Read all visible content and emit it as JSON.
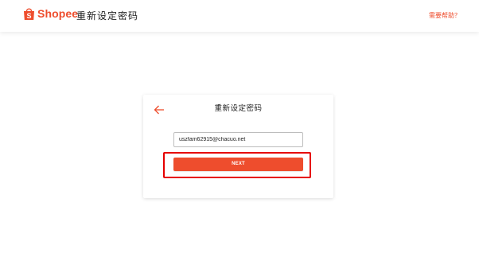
{
  "header": {
    "brand": "Shopee",
    "title": "重新设定密码",
    "help_link": "需要帮助？"
  },
  "card": {
    "title": "重新设定密码",
    "email_value": "uszfam62915@chacuo.net",
    "next_label": "NEXT"
  },
  "colors": {
    "brand": "#ee4d2d",
    "highlight": "#e60000"
  },
  "icons": {
    "logo": "shopee-bag-logo-icon",
    "back": "arrow-left-icon"
  }
}
